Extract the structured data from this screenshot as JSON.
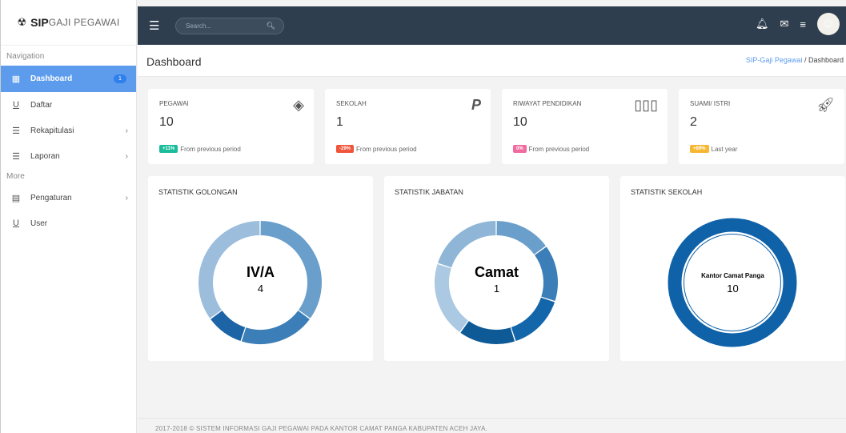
{
  "brand": {
    "name_bold": "SIP",
    "name_light": "GAJI PEGAWAI",
    "icon": "radiation-icon"
  },
  "sidebar": {
    "sections": [
      "Navigation",
      "More"
    ],
    "items": [
      {
        "label": "Dashboard",
        "icon": "dashboard-icon",
        "active": true,
        "badge": "1"
      },
      {
        "label": "Daftar",
        "icon": "underline-u-icon"
      },
      {
        "label": "Rekapitulasi",
        "icon": "list-icon",
        "has_children": true
      },
      {
        "label": "Laporan",
        "icon": "list-icon",
        "has_children": true
      },
      {
        "label": "Pengaturan",
        "icon": "table-icon",
        "has_children": true
      },
      {
        "label": "User",
        "icon": "underline-u-icon"
      }
    ]
  },
  "topbar": {
    "search_placeholder": "Search...",
    "icons": [
      "bell-icon",
      "mail-icon",
      "menu-icon",
      "avatar"
    ]
  },
  "header": {
    "title": "Dashboard",
    "breadcrumb": {
      "link": "SIP-Gaji Pegawai",
      "separator": "/",
      "current": "Dashboard"
    }
  },
  "stats": [
    {
      "label": "PEGAWAI",
      "value": "10",
      "badge": "+11%",
      "badge_color": "#1abc9c",
      "foot": "From previous period",
      "icon": "layers-icon"
    },
    {
      "label": "SEKOLAH",
      "value": "1",
      "badge": "-29%",
      "badge_color": "#f0553c",
      "foot": "From previous period",
      "icon": "paypal-icon"
    },
    {
      "label": "RIWAYAT PENDIDIKAN",
      "value": "10",
      "badge": "0%",
      "badge_color": "#f06aa0",
      "foot": "From previous period",
      "icon": "bar-chart-icon"
    },
    {
      "label": "SUAMI/ ISTRI",
      "value": "2",
      "badge": "+89%",
      "badge_color": "#f7b733",
      "foot": "Last year",
      "icon": "rocket-icon"
    }
  ],
  "charts": [
    {
      "title": "STATISTIK GOLONGAN",
      "center_label": "IV/A",
      "center_value": "4",
      "segment_colors": [
        "#6a9fcb",
        "#3c7fb8",
        "#1d64a7",
        "#9cbedc"
      ],
      "segment_values": [
        35,
        20,
        10,
        35
      ]
    },
    {
      "title": "STATISTIK JABATAN",
      "center_label": "Camat",
      "center_value": "1",
      "segment_colors": [
        "#6a9fcb",
        "#3c7fb8",
        "#1366aa",
        "#0d5a96",
        "#abc9e2",
        "#8fb6d6"
      ],
      "segment_values": [
        15,
        15,
        15,
        15,
        20,
        20
      ]
    },
    {
      "title": "STATISTIK SEKOLAH",
      "center_label": "Kantor Camat Panga",
      "center_value": "10",
      "segment_colors": [
        "#0f62a8"
      ],
      "segment_values": [
        100
      ]
    }
  ],
  "footer": {
    "text": "2017-2018 © SISTEM INFORMASI GAJI PEGAWAI PADA KANTOR CAMAT PANGA KABUPATEN ACEH JAYA."
  }
}
